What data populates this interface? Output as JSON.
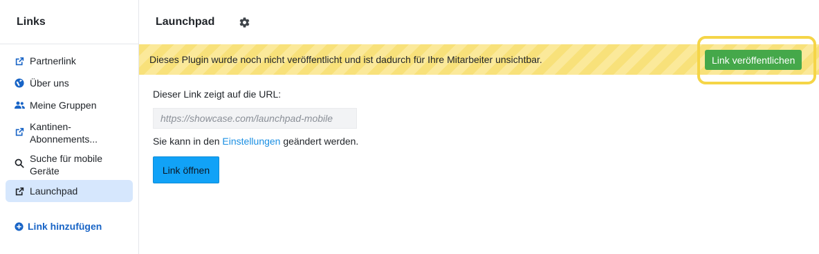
{
  "sidebar": {
    "title": "Links",
    "items": [
      {
        "label": "Partnerlink",
        "icon": "external-link-icon"
      },
      {
        "label": "Über uns",
        "icon": "globe-icon"
      },
      {
        "label": "Meine Gruppen",
        "icon": "group-icon"
      },
      {
        "label": "Kantinen-Abonnements...",
        "line1": "Kantinen-",
        "line2": "Abonnements...",
        "icon": "external-link-icon"
      },
      {
        "label": "Suche für mobile Geräte",
        "line1": "Suche für mobile",
        "line2": "Geräte",
        "icon": "search-icon"
      },
      {
        "label": "Launchpad",
        "icon": "external-link-icon",
        "active": true
      }
    ],
    "add_link_label": "Link hinzufügen"
  },
  "header": {
    "title": "Launchpad",
    "settings_icon": "gear-icon"
  },
  "banner": {
    "text": "Dieses Plugin wurde noch nicht veröffentlicht und ist dadurch für Ihre Mitarbeiter unsichtbar.",
    "publish_label": "Link veröffentlichen"
  },
  "content": {
    "url_label": "Dieser Link zeigt auf die URL:",
    "url_value": "https://showcase.com/launchpad-mobile",
    "settings_prefix": "Sie kann in den ",
    "settings_link": "Einstellungen",
    "settings_suffix": " geändert werden.",
    "open_label": "Link öffnen"
  },
  "colors": {
    "accent": "#1864c6",
    "active_bg": "#d6e7fd",
    "banner_yellow": "#f8e17a",
    "publish_green": "#45a84a",
    "open_blue": "#11a2f7",
    "highlight": "#f5d547"
  }
}
